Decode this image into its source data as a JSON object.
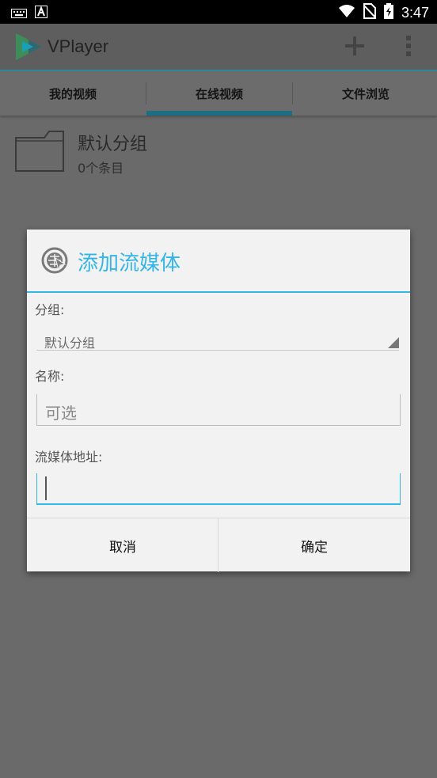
{
  "status_bar": {
    "time": "3:47"
  },
  "app_bar": {
    "title": "VPlayer"
  },
  "tabs": [
    {
      "label": "我的视频"
    },
    {
      "label": "在线视频"
    },
    {
      "label": "文件浏览"
    }
  ],
  "group": {
    "name": "默认分组",
    "count": "0个条目"
  },
  "dialog": {
    "title": "添加流媒体",
    "group_label": "分组:",
    "group_value": "默认分组",
    "name_label": "名称:",
    "name_placeholder": "可选",
    "url_label": "流媒体地址:",
    "url_value": "",
    "cancel": "取消",
    "ok": "确定"
  },
  "colors": {
    "accent": "#33b5e5",
    "tab_indicator": "#1c6f82"
  }
}
